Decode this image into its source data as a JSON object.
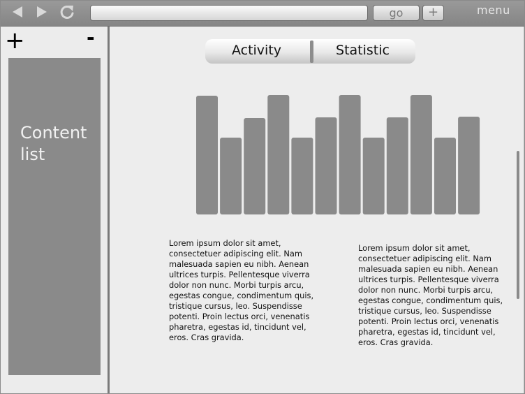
{
  "toolbar": {
    "back_icon": "back-arrow-icon",
    "forward_icon": "forward-arrow-icon",
    "reload_icon": "reload-icon",
    "url_value": "",
    "go_label": "go",
    "new_tab_label": "+",
    "menu_label": "menu"
  },
  "sidebar": {
    "add_label": "+",
    "remove_label": "-",
    "content_list_label": "Content list"
  },
  "main": {
    "tabs": [
      {
        "label": "Activity"
      },
      {
        "label": "Statistic"
      }
    ],
    "text_blocks": [
      "Lorem ipsum dolor sit amet, consectetuer adipiscing elit. Nam malesuada sapien eu nibh. Aenean ultrices turpis. Pellentesque viverra dolor non nunc. Morbi turpis arcu, egestas congue, condimentum quis, tristique cursus, leo. Suspendisse potenti. Proin lectus orci, venenatis pharetra, egestas id, tincidunt vel, eros. Cras gravida.",
      "Lorem ipsum dolor sit amet, consectetuer adipiscing elit. Nam malesuada sapien eu nibh. Aenean ultrices turpis. Pellentesque viverra dolor non nunc. Morbi turpis arcu, egestas congue, condimentum quis, tristique cursus, leo. Suspendisse potenti. Proin lectus orci, venenatis pharetra, egestas id, tincidunt vel, eros. Cras gravida."
    ]
  },
  "colors": {
    "toolbar": "#8f8f8f",
    "bar": "#8a8a8a",
    "sidebar_panel": "#8a8a8a",
    "background": "#ececec"
  },
  "chart_data": {
    "type": "bar",
    "values": [
      170,
      110,
      138,
      171,
      110,
      139,
      171,
      110,
      139,
      171,
      110,
      140
    ],
    "ylim": [
      0,
      175
    ],
    "grid": false
  }
}
